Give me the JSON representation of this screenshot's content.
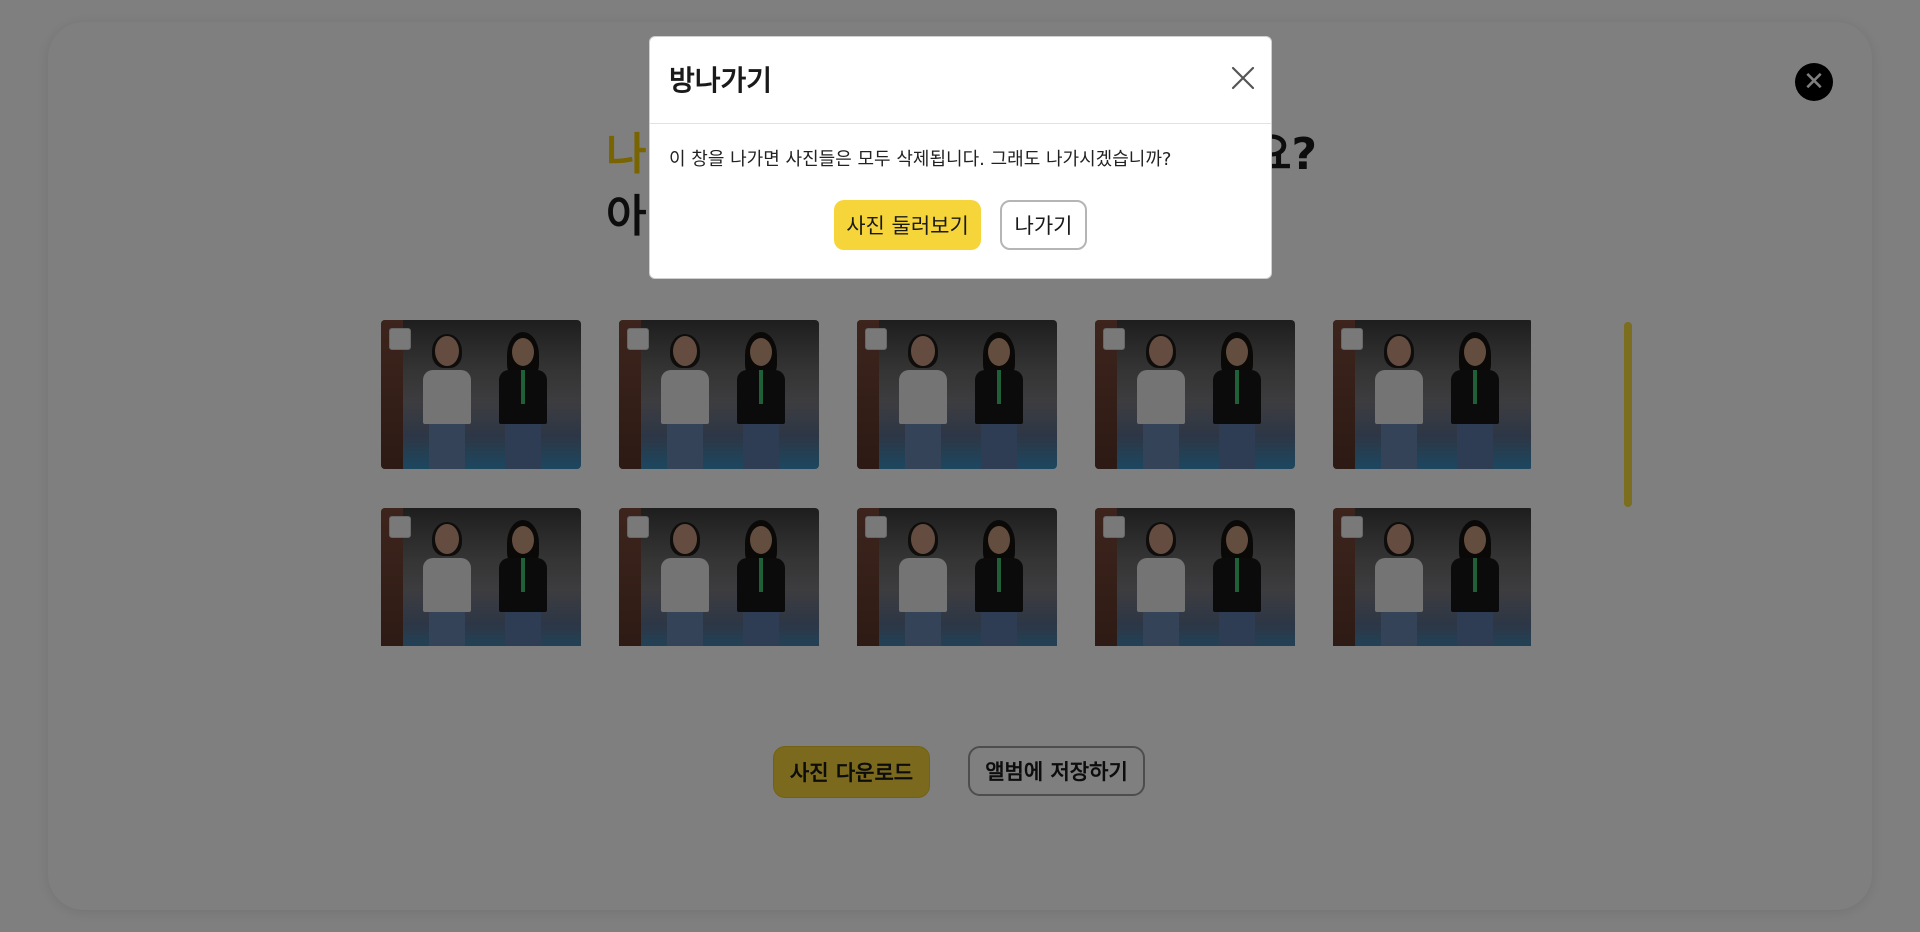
{
  "page": {
    "headline_line1_start": "나",
    "headline_line1_end": "요?",
    "headline_line2_start": "아",
    "download_button": "사진 다운로드",
    "album_button": "앨범에 저장하기",
    "close_icon_glyph": "✕"
  },
  "photos": [
    {
      "row": 1,
      "checked": false
    },
    {
      "row": 1,
      "checked": false
    },
    {
      "row": 1,
      "checked": false
    },
    {
      "row": 1,
      "checked": false
    },
    {
      "row": 1,
      "checked": false
    },
    {
      "row": 2,
      "checked": false
    },
    {
      "row": 2,
      "checked": false
    },
    {
      "row": 2,
      "checked": false
    },
    {
      "row": 2,
      "checked": false
    },
    {
      "row": 2,
      "checked": false
    }
  ],
  "modal": {
    "title": "방나가기",
    "message": "이 창을 나가면 사진들은 모두 삭제됩니다. 그래도 나가시겠습니까?",
    "browse_button": "사진 둘러보기",
    "exit_button": "나가기"
  },
  "colors": {
    "accent": "#f6d53a",
    "headline_highlight": "#f0c800",
    "overlay": "rgba(0,0,0,0.5)"
  }
}
